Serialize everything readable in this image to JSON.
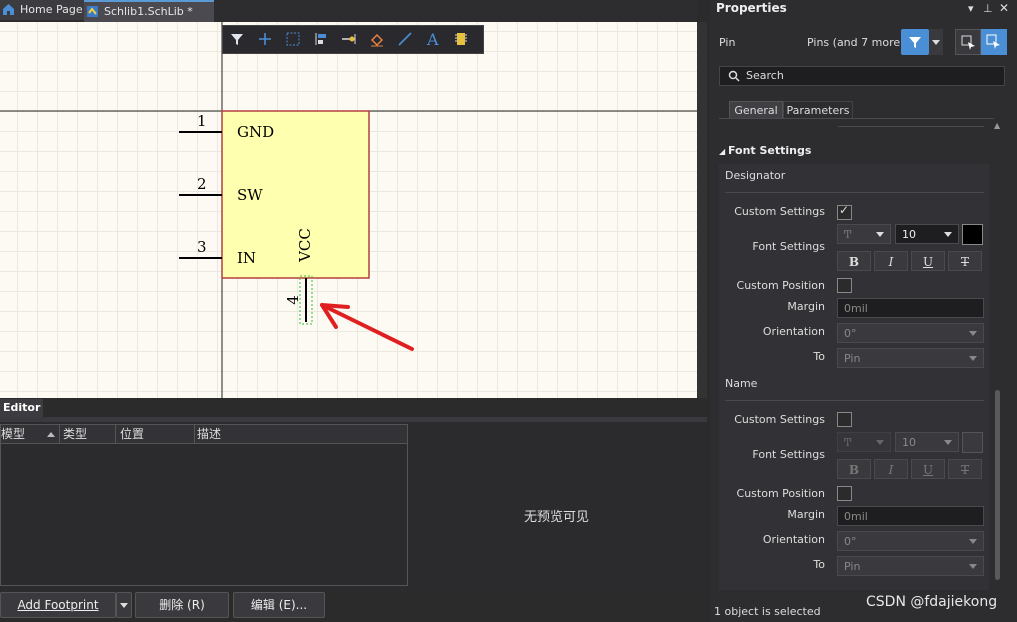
{
  "tabs": [
    {
      "label": "Home Page"
    },
    {
      "label": "Schlib1.SchLib *"
    }
  ],
  "schematic": {
    "pins": [
      {
        "number": "1",
        "name": "GND"
      },
      {
        "number": "2",
        "name": "SW"
      },
      {
        "number": "3",
        "name": "IN"
      },
      {
        "number": "4",
        "name": "VCC"
      }
    ]
  },
  "toolbar": {
    "icons": [
      "filter-icon",
      "cross-icon",
      "select-rect-icon",
      "align-icon",
      "pin-icon",
      "eraser-icon",
      "line-icon",
      "text-icon",
      "component-icon"
    ]
  },
  "editor": {
    "title": "Editor",
    "columns": [
      "模型",
      "类型",
      "位置",
      "描述"
    ],
    "preview_text": "无预览可见",
    "add_footprint": "Add Footprint",
    "delete": "删除 (R)",
    "edit": "编辑 (E)..."
  },
  "properties": {
    "title": "Properties",
    "object_type": "Pin",
    "filter_label": "Pins (and 7 more)",
    "search_placeholder": "Search",
    "tabs": [
      "General",
      "Parameters"
    ],
    "section": "Font Settings",
    "designator": {
      "title": "Designator",
      "custom_settings_label": "Custom Settings",
      "font_settings_label": "Font Settings",
      "font_size": "10",
      "bold": "B",
      "italic": "I",
      "underline": "U",
      "strike": "T",
      "custom_position_label": "Custom Position",
      "margin_label": "Margin",
      "margin_value": "0mil",
      "orientation_label": "Orientation",
      "orientation_value": "0°",
      "to_label": "To",
      "to_value": "Pin"
    },
    "name": {
      "title": "Name",
      "custom_settings_label": "Custom Settings",
      "font_settings_label": "Font Settings",
      "font_size": "10",
      "bold": "B",
      "italic": "I",
      "underline": "U",
      "strike": "T",
      "custom_position_label": "Custom Position",
      "margin_label": "Margin",
      "margin_value": "0mil",
      "orientation_label": "Orientation",
      "orientation_value": "0°",
      "to_label": "To",
      "to_value": "Pin"
    },
    "status": "1 object is selected"
  },
  "watermark": "CSDN @fdajiekong",
  "colors": {
    "accent": "#4a8fd6",
    "component_fill": "#ffffb0",
    "component_border": "#b34040",
    "arrow": "#e02020"
  }
}
